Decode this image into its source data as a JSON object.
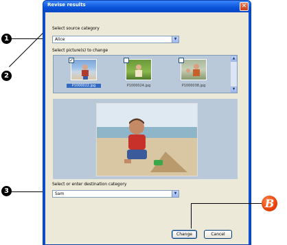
{
  "window": {
    "title": "Revise results",
    "close_glyph": "✕"
  },
  "source": {
    "label": "Select source category",
    "value": "Alice"
  },
  "pictures": {
    "label": "Select picture(s) to change",
    "items": [
      {
        "filename": "P1000022.jpg",
        "checked": true,
        "check_glyph": "✓",
        "selected": true
      },
      {
        "filename": "P1000024.jpg",
        "checked": false,
        "check_glyph": "",
        "selected": false
      },
      {
        "filename": "P1000038.jpg",
        "checked": false,
        "check_glyph": "",
        "selected": false
      }
    ]
  },
  "destination": {
    "label": "Select or enter destination category",
    "value": "Sam"
  },
  "buttons": {
    "change": "Change",
    "cancel": "Cancel"
  },
  "callouts": {
    "c1": "1",
    "c2": "2",
    "c3": "3",
    "cb": "B"
  },
  "colors": {
    "title_bar": "#0a52d8",
    "face": "#ece9d8",
    "callout_b": "#e8430c"
  }
}
